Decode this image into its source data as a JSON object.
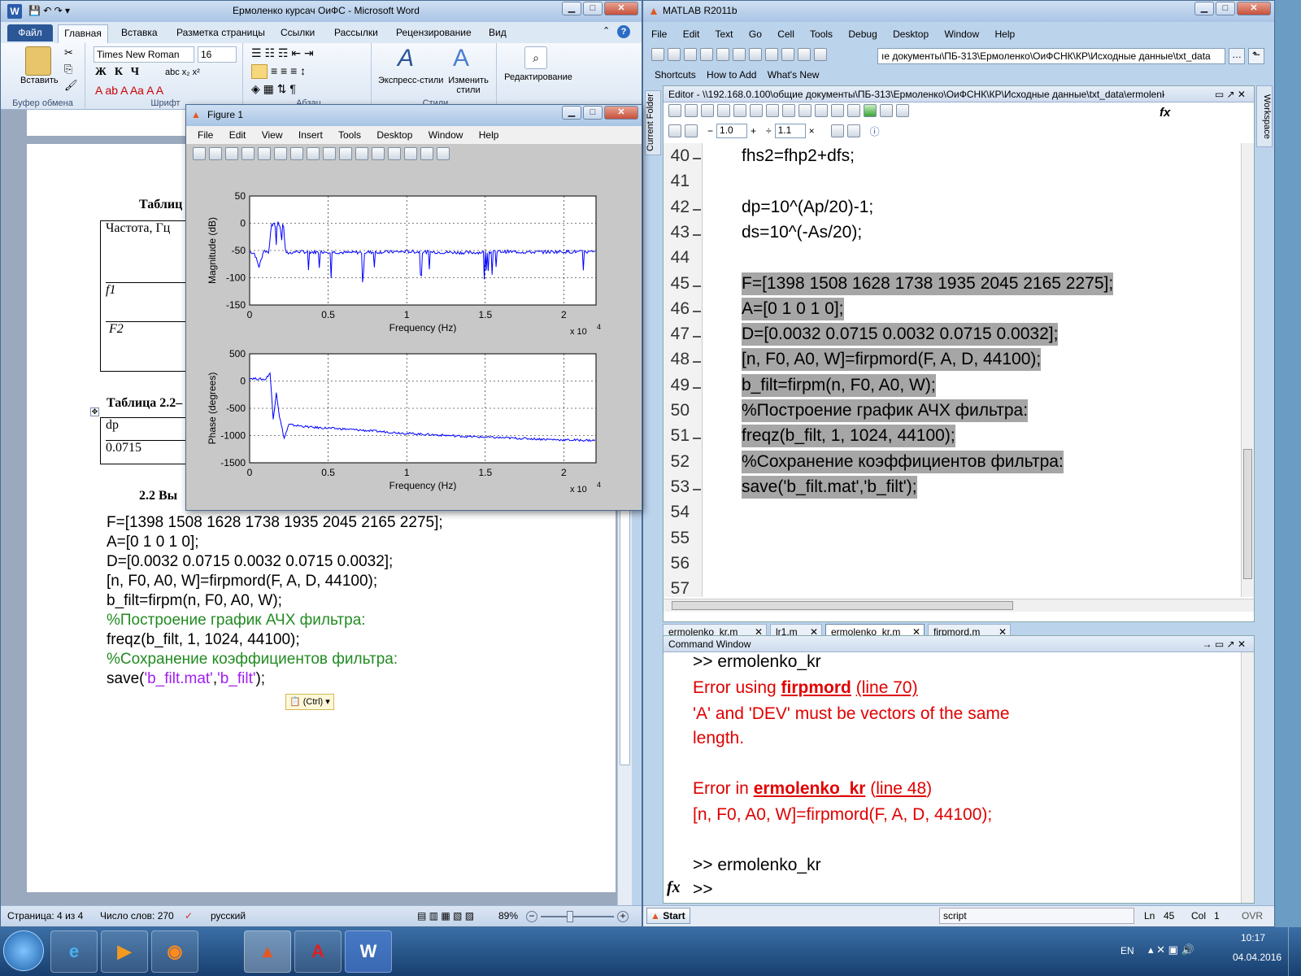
{
  "word": {
    "title": "Ермоленко курсач ОиФС - Microsoft Word",
    "tabs": [
      "Файл",
      "Главная",
      "Вставка",
      "Разметка страницы",
      "Ссылки",
      "Рассылки",
      "Рецензирование",
      "Вид"
    ],
    "font_name": "Times New Roman",
    "font_size": "16",
    "groups": {
      "clipboard": "Буфер обмена",
      "font": "Шрифт",
      "paragraph": "Абзац",
      "styles": "Стили"
    },
    "paste_label": "Вставить",
    "express_styles": "Экспресс-стили",
    "change_styles": "Изменить стили",
    "editing": "Редактирование",
    "doc": {
      "table1_caption": "Таблиц",
      "table1_rows": [
        "Частота, Гц",
        "f1",
        "F2"
      ],
      "table2_caption": "Таблица 2.2–",
      "table2_rows": [
        "dp",
        "0.0715"
      ],
      "section": "2.2 Вы",
      "code": [
        {
          "text": "F=[1398 1508 1628 1738 1935 2045 2165 2275];",
          "style": "normal"
        },
        {
          "text": "A=[0 1 0 1 0];",
          "style": "normal"
        },
        {
          "text": "D=[0.0032 0.0715 0.0032 0.0715 0.0032];",
          "style": "normal"
        },
        {
          "text": "[n, F0, A0, W]=firpmord(F, A, D, 44100);",
          "style": "normal"
        },
        {
          "text": "b_filt=firpm(n, F0, A0, W);",
          "style": "normal"
        },
        {
          "text": "%Построение график АЧХ фильтра:",
          "style": "green"
        },
        {
          "text": "freqz(b_filt, 1, 1024, 44100);",
          "style": "normal"
        },
        {
          "text": "%Сохранение коэффициентов фильтра:",
          "style": "green"
        }
      ],
      "save_line": {
        "pre": "save(",
        "s1": "'b_filt.mat'",
        "mid": ",",
        "s2": "'b_filt'",
        "post": ");"
      },
      "paste_tag": "(Ctrl)"
    },
    "status": {
      "page": "Страница: 4 из 4",
      "words": "Число слов: 270",
      "lang": "русский",
      "zoom": "89%"
    }
  },
  "figure": {
    "title": "Figure 1",
    "menu": [
      "File",
      "Edit",
      "View",
      "Insert",
      "Tools",
      "Desktop",
      "Window",
      "Help"
    ]
  },
  "chart_data": [
    {
      "type": "line",
      "xlabel": "Frequency (Hz)",
      "ylabel": "Magnitude (dB)",
      "xlim": [
        0,
        22050
      ],
      "ylim": [
        -150,
        50
      ],
      "x_ticks": [
        "0",
        "0.5",
        "1",
        "1.5",
        "2"
      ],
      "y_ticks": [
        "50",
        "0",
        "-50",
        "-100",
        "-150"
      ],
      "x_multiplier": "x 10",
      "x_multiplier_exp": "4",
      "grid": true,
      "color": "#0000ff",
      "x": [
        0,
        300,
        600,
        900,
        1200,
        1398,
        1500,
        1628,
        1700,
        1738,
        1800,
        1935,
        2045,
        2100,
        2165,
        2275,
        2400,
        3000,
        4000,
        5000,
        6000,
        8000,
        10000,
        12000,
        14000,
        16000,
        18000,
        20000,
        22050
      ],
      "values": [
        -52,
        -55,
        -80,
        -50,
        -53,
        -5,
        0,
        -5,
        -40,
        -5,
        0,
        -5,
        -30,
        -3,
        -5,
        -50,
        -55,
        -52,
        -53,
        -52,
        -54,
        -53,
        -52,
        -53,
        -54,
        -52,
        -53,
        -52,
        -53
      ]
    },
    {
      "type": "line",
      "xlabel": "Frequency (Hz)",
      "ylabel": "Phase (degrees)",
      "xlim": [
        0,
        22050
      ],
      "ylim": [
        -1500,
        500
      ],
      "x_ticks": [
        "0",
        "0.5",
        "1",
        "1.5",
        "2"
      ],
      "y_ticks": [
        "500",
        "0",
        "-500",
        "-1000",
        "-1500"
      ],
      "x_multiplier": "x 10",
      "x_multiplier_exp": "4",
      "grid": true,
      "color": "#0000ff",
      "x": [
        0,
        500,
        1000,
        1300,
        1500,
        1700,
        1900,
        2200,
        2500,
        4000,
        6000,
        8000,
        10000,
        12000,
        14000,
        16000,
        18000,
        20000,
        22050
      ],
      "values": [
        50,
        40,
        30,
        150,
        -700,
        -200,
        -650,
        -1050,
        -800,
        -850,
        -880,
        -920,
        -960,
        -990,
        -1020,
        -1040,
        -1060,
        -1080,
        -1090
      ]
    }
  ],
  "matlab": {
    "title": "MATLAB  R2011b",
    "menu": [
      "File",
      "Edit",
      "Text",
      "Go",
      "Cell",
      "Tools",
      "Debug",
      "Desktop",
      "Window",
      "Help"
    ],
    "path": "ıe документы\\ПБ-313\\Ермоленко\\ОиФСНК\\КР\\Исходные данные\\txt_data",
    "shortcuts": [
      "Shortcuts",
      "How to Add",
      "What's New"
    ],
    "side_left": "Current Folder",
    "side_right": "Workspace",
    "editor_title": "Editor - \\\\192.168.0.100\\общие документы\\ПБ-313\\Ермоленко\\ОиФСНК\\КР\\Исходные данные\\txt_data\\ermolenko...",
    "cell_values": [
      "1.0",
      "1.1"
    ],
    "lines": [
      {
        "n": "40",
        "code": "fhs2=fhp2+dfs;",
        "dash": true,
        "hl": false
      },
      {
        "n": "41",
        "code": "",
        "dash": false,
        "hl": false
      },
      {
        "n": "42",
        "code": "dp=10^(Ap/20)-1;",
        "dash": true,
        "hl": false
      },
      {
        "n": "43",
        "code": "ds=10^(-As/20);",
        "dash": true,
        "hl": false
      },
      {
        "n": "44",
        "code": "",
        "dash": false,
        "hl": false
      },
      {
        "n": "45",
        "code": "F=[1398 1508 1628 1738 1935 2045 2165 2275];",
        "dash": true,
        "hl": true
      },
      {
        "n": "46",
        "code": "A=[0 1 0 1 0];",
        "dash": true,
        "hl": true
      },
      {
        "n": "47",
        "code": "D=[0.0032 0.0715 0.0032 0.0715 0.0032];",
        "dash": true,
        "hl": true
      },
      {
        "n": "48",
        "code": "[n, F0, A0, W]=firpmord(F, A, D, 44100);",
        "dash": true,
        "hl": true
      },
      {
        "n": "49",
        "code": "b_filt=firpm(n, F0, A0, W);",
        "dash": true,
        "hl": true
      },
      {
        "n": "50",
        "code": "%Построение график АЧХ фильтра:",
        "dash": false,
        "hl": true
      },
      {
        "n": "51",
        "code": "freqz(b_filt, 1, 1024, 44100);",
        "dash": true,
        "hl": true
      },
      {
        "n": "52",
        "code": "%Сохранение коэффициентов фильтра:",
        "dash": false,
        "hl": true
      },
      {
        "n": "53",
        "code": "save('b_filt.mat','b_filt');",
        "dash": true,
        "hl": true
      },
      {
        "n": "54",
        "code": "",
        "dash": false,
        "hl": false
      },
      {
        "n": "55",
        "code": "",
        "dash": false,
        "hl": false
      },
      {
        "n": "56",
        "code": "",
        "dash": false,
        "hl": false
      },
      {
        "n": "57",
        "code": "",
        "dash": false,
        "hl": false
      }
    ],
    "file_tabs": [
      "ermolenko_kr.m",
      "lr1.m",
      "ermolenko_kr.m",
      "firpmord.m"
    ],
    "command_window": {
      "title": "Command Window",
      "prompt1": ">> ermolenko_kr",
      "err1_pre": "Error using ",
      "err1_fn": "firpmord",
      "err1_line": "(line 70)",
      "err1_msg1": "'A' and 'DEV' must be vectors of the same",
      "err1_msg2": "length.",
      "err2_pre": "Error in ",
      "err2_fn": "ermolenko_kr",
      "err2_line_open": "(",
      "err2_line": "line 48",
      "err2_line_close": ")",
      "err2_code": "[n, F0, A0, W]=firpmord(F, A, D, 44100);",
      "prompt2": ">> ermolenko_kr",
      "prompt3": ">>",
      "fx": "fx"
    },
    "status": {
      "start": "Start",
      "mode": "script",
      "ln_label": "Ln",
      "ln": "45",
      "col_label": "Col",
      "col": "1",
      "ovr": "OVR"
    }
  },
  "taskbar": {
    "lang": "EN",
    "time": "10:17",
    "date": "04.04.2016"
  }
}
